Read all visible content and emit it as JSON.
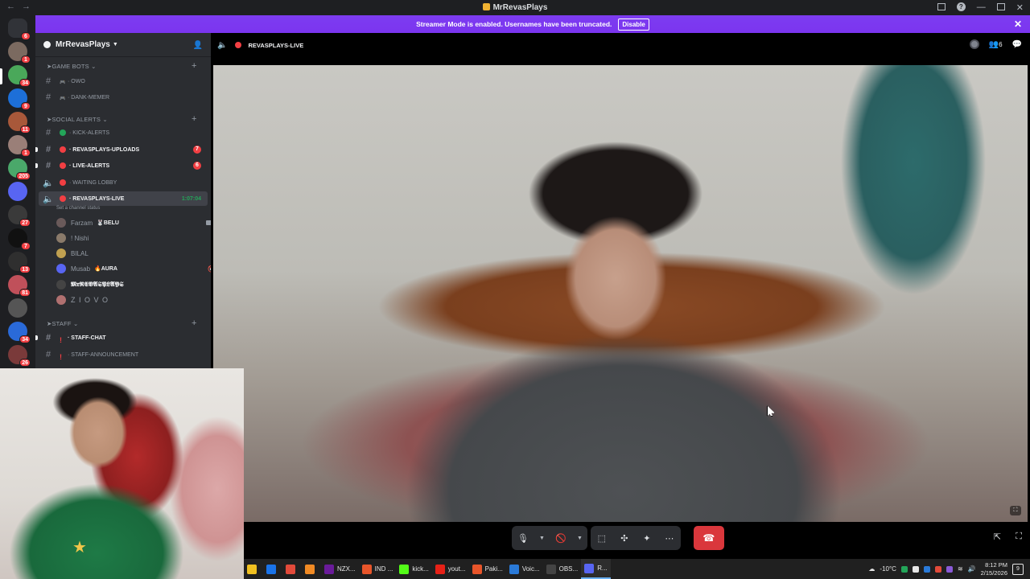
{
  "window": {
    "title": "MrRevasPlays"
  },
  "banner": {
    "text": "Streamer Mode is enabled. Usernames have been truncated.",
    "button": "Disable"
  },
  "rail": {
    "servers": [
      {
        "color": "#313338",
        "badge": "6"
      },
      {
        "color": "#7b6a60",
        "badge": "1"
      },
      {
        "color": "#4aa85a",
        "badge": "34"
      },
      {
        "color": "#1d6fd8",
        "badge": "9"
      },
      {
        "color": "#a8583a",
        "badge": "11"
      },
      {
        "color": "#9a7f78",
        "badge": "1"
      },
      {
        "color": "#4aa86a",
        "badge": "205"
      },
      {
        "color": "#5865f2",
        "badge": ""
      },
      {
        "color": "#3a3a3a",
        "badge": "27"
      },
      {
        "color": "#111111",
        "badge": "7"
      },
      {
        "color": "#2f2f2f",
        "badge": "13"
      },
      {
        "color": "#c0505a",
        "badge": "81"
      },
      {
        "color": "#555555",
        "badge": ""
      },
      {
        "color": "#2a6ad8",
        "badge": "34"
      },
      {
        "color": "#7a3a3a",
        "badge": "26"
      }
    ]
  },
  "sidebar": {
    "guild_name": "MrRevasPlays",
    "categories": [
      {
        "label": "➤GAME BOTS"
      },
      {
        "label": "➤SOCIAL ALERTS"
      },
      {
        "label": "➤STAFF"
      }
    ],
    "channels": [
      {
        "label": "· OWO",
        "marker": "bot",
        "unread": false,
        "count": ""
      },
      {
        "label": "· DANK-MEMER",
        "marker": "bot",
        "unread": false,
        "count": ""
      },
      {
        "label": "· KICK-ALERTS",
        "marker": "#23a559",
        "unread": false,
        "count": ""
      },
      {
        "label": "· REVASPLAYS-UPLOADS",
        "marker": "#f23f43",
        "unread": true,
        "count": "7"
      },
      {
        "label": "· LIVE-ALERTS",
        "marker": "#f23f43",
        "unread": true,
        "count": "6"
      },
      {
        "label": "· WAITING LOBBY",
        "marker": "#f23f43",
        "unread": false,
        "count": ""
      },
      {
        "label": "· REVASPLAYS-LIVE",
        "marker": "#f23f43",
        "unread": false,
        "count": "",
        "timer": "1:07:04",
        "status": "Set a channel status"
      },
      {
        "label": "· STAFF-CHAT",
        "marker": "!",
        "unread": true,
        "count": ""
      },
      {
        "label": "· STAFF-ANNOUNCEMENT",
        "marker": "!",
        "unread": false,
        "count": ""
      }
    ],
    "voice_users": [
      {
        "name": "Farzam",
        "tag": "🐰BELU",
        "live": "LIVE",
        "avatar": "#6a5a5a"
      },
      {
        "name": "! Nishi",
        "tag": "",
        "live": "",
        "avatar": "#8a7a6a"
      },
      {
        "name": "BILAL",
        "tag": "",
        "live": "",
        "avatar": "#c0a050"
      },
      {
        "name": "Musab",
        "tag": "🔥AURA",
        "live": "",
        "avatar": "#5865f2"
      },
      {
        "name": "𝕸𝖗𝕽𝕰𝖁𝕬𝕾𝕻𝕷𝕬𝖄𝕾",
        "tag": "",
        "live": "",
        "avatar": "#444444"
      },
      {
        "name": "Z I O V O",
        "tag": "",
        "live": "",
        "avatar": "#b07070"
      }
    ]
  },
  "stage": {
    "channel_name": "REVASPLAYS-LIVE",
    "participants": "6"
  },
  "taskbar": {
    "apps": [
      {
        "label": "",
        "color": "#f0c020"
      },
      {
        "label": "",
        "color": "#1a73e8"
      },
      {
        "label": "",
        "color": "#e24a3a"
      },
      {
        "label": "",
        "color": "#f08a24"
      },
      {
        "label": "NZX...",
        "color": "#6a1b9a"
      },
      {
        "label": "IND ...",
        "color": "#e8552a"
      },
      {
        "label": "kick...",
        "color": "#53fc18"
      },
      {
        "label": "yout...",
        "color": "#e62117"
      },
      {
        "label": "Paki...",
        "color": "#e8552a"
      },
      {
        "label": "Voic...",
        "color": "#2a7ad8"
      },
      {
        "label": "OBS...",
        "color": "#444444"
      },
      {
        "label": "R...",
        "color": "#5865f2"
      }
    ],
    "weather": "-10°C",
    "time": "8:12 PM",
    "date": "2/15/2026",
    "notifications": "9"
  }
}
